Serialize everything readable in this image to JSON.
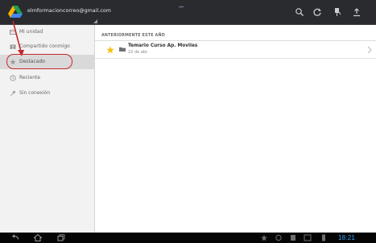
{
  "header": {
    "account_email": "elmformacioncorreo@gmail.com",
    "badge": "***"
  },
  "sidebar": {
    "items": [
      {
        "label": "Mi unidad",
        "icon": "drive-icon"
      },
      {
        "label": "Compartido conmigo",
        "icon": "shared-icon"
      },
      {
        "label": "Destacado",
        "icon": "star-icon",
        "active": true
      },
      {
        "label": "Reciente",
        "icon": "clock-icon"
      },
      {
        "label": "Sin conexión",
        "icon": "pin-icon"
      }
    ]
  },
  "main": {
    "section_title": "ANTERIORMENTE ESTE AÑO",
    "files": [
      {
        "name": "Temario Curso Ap. Moviles",
        "date": "22 de abr."
      }
    ]
  },
  "status_bar": {
    "clock": "18:21"
  },
  "colors": {
    "top_bar": "#2a2b2f",
    "sidebar_bg": "#f2f2f2",
    "active_item_bg": "#d9d9d9",
    "annotation": "#c62828",
    "star": "#f4c20d",
    "clock": "#3aa4ff"
  }
}
